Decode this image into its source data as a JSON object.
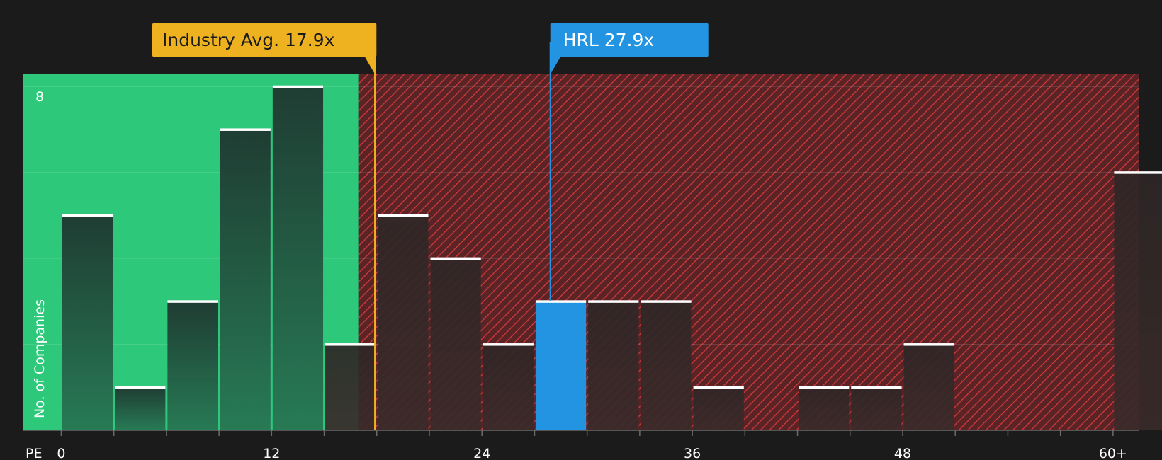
{
  "chart_data": {
    "type": "bar",
    "title": "",
    "xlabel": "PE",
    "ylabel": "No. of Companies",
    "xlim": [
      -2.2,
      61.5
    ],
    "ylim": [
      0,
      8.3
    ],
    "bin_width": 3,
    "x_ticks": [
      {
        "value": 0,
        "label": "0"
      },
      {
        "value": 12,
        "label": "12"
      },
      {
        "value": 24,
        "label": "24"
      },
      {
        "value": 36,
        "label": "36"
      },
      {
        "value": 48,
        "label": "48"
      },
      {
        "value": 60,
        "label": "60+"
      }
    ],
    "y_ticks": [
      {
        "value": 8,
        "label": "8"
      }
    ],
    "grid": true,
    "bins": [
      {
        "x0": 0,
        "count": 5
      },
      {
        "x0": 3,
        "count": 1
      },
      {
        "x0": 6,
        "count": 3
      },
      {
        "x0": 9,
        "count": 7
      },
      {
        "x0": 12,
        "count": 8
      },
      {
        "x0": 15,
        "count": 2
      },
      {
        "x0": 18,
        "count": 5
      },
      {
        "x0": 21,
        "count": 4
      },
      {
        "x0": 24,
        "count": 2
      },
      {
        "x0": 27,
        "count": 3,
        "highlight": true
      },
      {
        "x0": 30,
        "count": 3
      },
      {
        "x0": 33,
        "count": 3
      },
      {
        "x0": 36,
        "count": 1
      },
      {
        "x0": 42,
        "count": 1
      },
      {
        "x0": 45,
        "count": 1
      },
      {
        "x0": 48,
        "count": 2
      },
      {
        "x0": 60,
        "count": 6
      }
    ],
    "industry_avg": {
      "value": 17.9,
      "label": "Industry Avg. 17.9x"
    },
    "company": {
      "value": 27.9,
      "label": "HRL 27.9x"
    },
    "colors": {
      "background": "#1b1b1b",
      "undervalued_zone": "#2ec87b",
      "overvalued_zone": "#5a2426",
      "hatch": "#d33a3a",
      "bar_dark": "#21493a",
      "bar_muted": "#352a2a",
      "bar_highlight": "#2394e1",
      "bar_cap": "#ffffff",
      "industry": "#eeb221",
      "company": "#2394e1",
      "text": "#ffffff"
    }
  }
}
